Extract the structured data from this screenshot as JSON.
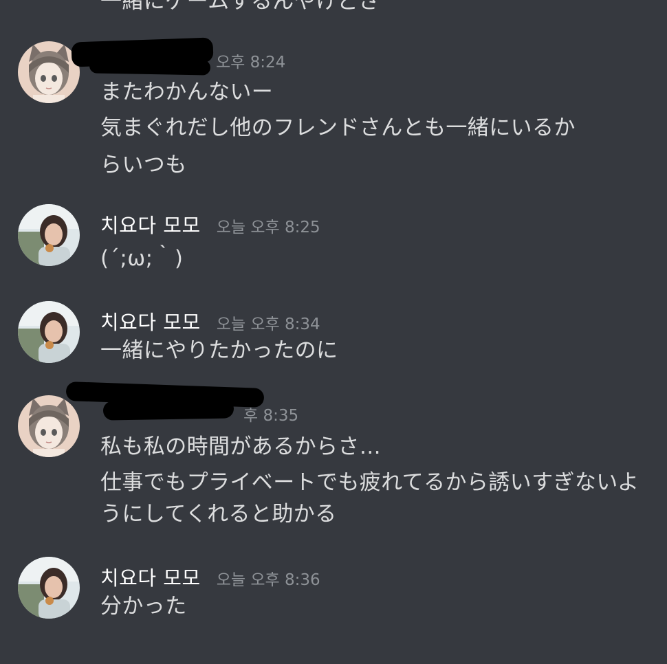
{
  "top_partial_text": "一緒にゲームするんやけどさ",
  "messages": [
    {
      "author": "",
      "timestamp": "오후 8:24",
      "avatar": "cat-ear-girl-avatar",
      "lines": [
        "またわかんないー",
        "気まぐれだし他のフレンドさんとも一緒にいるか",
        "らいつも"
      ]
    },
    {
      "author": "치요다 모모",
      "timestamp": "오늘 오후 8:25",
      "avatar": "photo-girl-avatar",
      "lines": [
        "(´;ω;｀)"
      ]
    },
    {
      "author": "치요다 모모",
      "timestamp": "오늘 오후 8:34",
      "avatar": "photo-girl-avatar",
      "lines": [
        "一緒にやりたかったのに"
      ]
    },
    {
      "author": "",
      "timestamp": "후 8:35",
      "avatar": "cat-ear-girl-avatar",
      "lines": [
        "私も私の時間があるからさ…",
        "仕事でもプライベートでも疲れてるから誘いすぎないよ",
        "うにしてくれると助かる"
      ]
    },
    {
      "author": "치요다 모모",
      "timestamp": "오늘 오후 8:36",
      "avatar": "photo-girl-avatar",
      "lines": [
        "分かった"
      ]
    }
  ]
}
